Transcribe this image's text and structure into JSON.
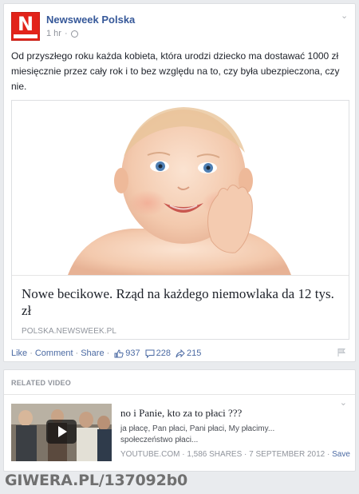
{
  "post": {
    "page_name": "Newsweek Polska",
    "logo_letter": "N",
    "time": "1 hr",
    "text": "Od przyszłego roku każda kobieta, która urodzi dziecko ma dostawać 1000 zł miesięcznie przez cały rok i to bez względu na to, czy była ubezpieczona, czy nie.",
    "link": {
      "title": "Nowe becikowe. Rząd na każdego niemowlaka da 12 tys. zł",
      "domain": "POLSKA.NEWSWEEK.PL"
    },
    "actions": {
      "like": "Like",
      "comment": "Comment",
      "share": "Share",
      "like_count": "937",
      "comment_count": "228",
      "share_count": "215"
    }
  },
  "related": {
    "header": "RELATED VIDEO",
    "video": {
      "title": "no i Panie, kto za to płaci ???",
      "description": "ja płacę, Pan płaci, Pani płaci, My płacimy... społeczeństwo płaci...",
      "meta": "YOUTUBE.COM · 1,586 SHARES · 7 SEPTEMBER 2012",
      "save": "Save"
    }
  },
  "watermark": "GIWERA.PL/137092b0",
  "colors": {
    "link_blue": "#365899",
    "brand_red": "#e2231a",
    "background": "#e9ebee"
  }
}
